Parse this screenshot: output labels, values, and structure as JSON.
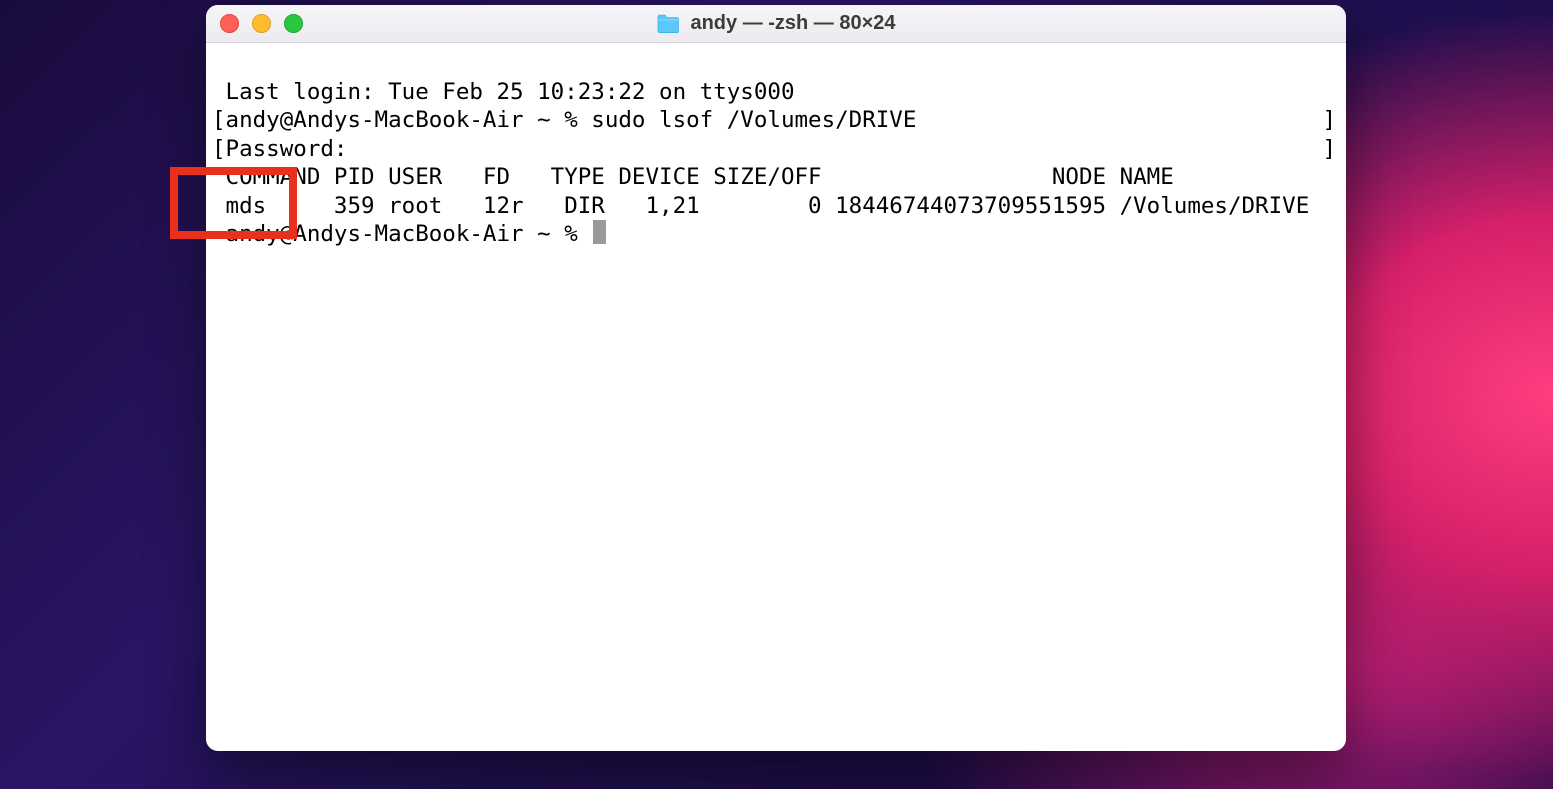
{
  "window": {
    "title": "andy — -zsh — 80×24"
  },
  "terminal": {
    "last_login": "Last login: Tue Feb 25 10:23:22 on ttys000",
    "prompt1_open": "[",
    "prompt1_userhost": "andy@Andys-MacBook-Air ~ % ",
    "command1": "sudo lsof /Volumes/DRIVE",
    "prompt1_close": "]",
    "password_open": "[",
    "password_label": "Password:",
    "password_close": "]",
    "header_line": "COMMAND PID USER   FD   TYPE DEVICE SIZE/OFF                 NODE NAME",
    "row_line": "mds     359 root   12r   DIR   1,21        0 18446744073709551595 /Volumes/DRIVE",
    "prompt2": "andy@Andys-MacBook-Air ~ % "
  },
  "annotation": {
    "note": "red box highlights the mds COMMAND cell"
  }
}
